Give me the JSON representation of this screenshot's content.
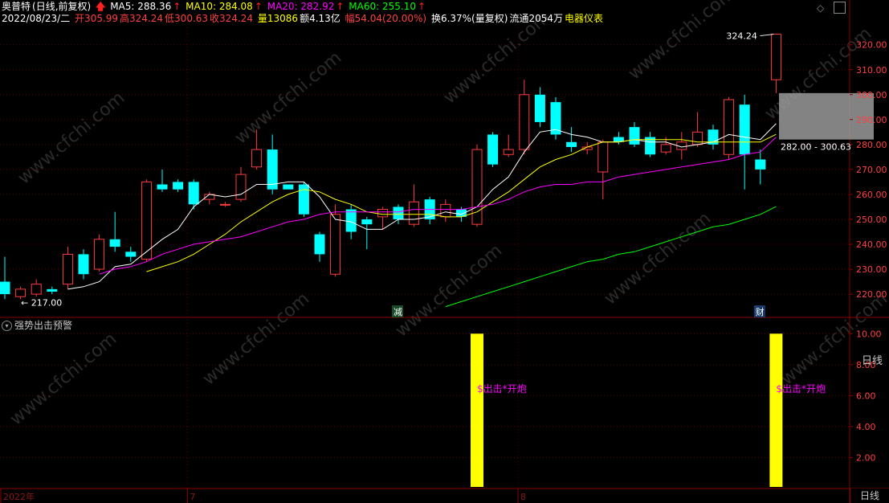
{
  "header": {
    "stock_name": "奥普特",
    "period": "(日线,前复权)",
    "ma5_label": "MA5: 288.36",
    "ma10_label": "MA10: 284.08",
    "ma20_label": "MA20: 282.92",
    "ma60_label": "MA60: 255.10",
    "date": "2022/08/23/二",
    "open": "开305.99",
    "high": "高324.24",
    "low": "低300.63",
    "close": "收324.24",
    "volume": "量13086",
    "amount": "额4.13亿",
    "change": "幅54.04(20.00%)",
    "turnover": "换6.37%(量复权)",
    "float": "流通2054万",
    "sector": "电器仪表"
  },
  "colors": {
    "up": "#ff3c3c",
    "down": "#00ffff",
    "ma5": "#ffffff",
    "ma10": "#ffff00",
    "ma20": "#ff00ff",
    "ma60": "#00ff00",
    "indicator_bar": "#ffff00",
    "indicator_text": "#ff00ff"
  },
  "chart_data": {
    "type": "candlestick",
    "ylim": [
      211,
      327
    ],
    "y_ticks": [
      "320.00",
      "310.00",
      "300.00",
      "290.00",
      "280.00",
      "270.00",
      "260.00",
      "250.00",
      "240.00",
      "230.00",
      "220.00"
    ],
    "candles": [
      {
        "o": 225,
        "c": 220,
        "h": 235,
        "l": 218
      },
      {
        "o": 219,
        "c": 222,
        "h": 223,
        "l": 218
      },
      {
        "o": 220,
        "c": 224,
        "h": 226,
        "l": 219
      },
      {
        "o": 222,
        "c": 221,
        "h": 223,
        "l": 220
      },
      {
        "o": 224,
        "c": 236,
        "h": 239,
        "l": 222
      },
      {
        "o": 236,
        "c": 228,
        "h": 238,
        "l": 226
      },
      {
        "o": 230,
        "c": 242,
        "h": 244,
        "l": 229
      },
      {
        "o": 242,
        "c": 239,
        "h": 253,
        "l": 237
      },
      {
        "o": 237,
        "c": 235,
        "h": 239,
        "l": 233
      },
      {
        "o": 234,
        "c": 265,
        "h": 266,
        "l": 233
      },
      {
        "o": 264,
        "c": 262,
        "h": 270,
        "l": 261
      },
      {
        "o": 265,
        "c": 262,
        "h": 266,
        "l": 261
      },
      {
        "o": 265,
        "c": 256,
        "h": 266,
        "l": 254
      },
      {
        "o": 258,
        "c": 260,
        "h": 261,
        "l": 256
      },
      {
        "o": 256,
        "c": 256,
        "h": 257,
        "l": 255
      },
      {
        "o": 258,
        "c": 268,
        "h": 271,
        "l": 257
      },
      {
        "o": 271,
        "c": 278,
        "h": 286,
        "l": 270
      },
      {
        "o": 278,
        "c": 262,
        "h": 284,
        "l": 260
      },
      {
        "o": 264,
        "c": 262,
        "h": 263,
        "l": 262
      },
      {
        "o": 264,
        "c": 252,
        "h": 265,
        "l": 251
      },
      {
        "o": 244,
        "c": 236,
        "h": 245,
        "l": 233
      },
      {
        "o": 228,
        "c": 252,
        "h": 256,
        "l": 227
      },
      {
        "o": 254,
        "c": 245,
        "h": 256,
        "l": 242
      },
      {
        "o": 250,
        "c": 248,
        "h": 251,
        "l": 238
      },
      {
        "o": 251,
        "c": 254,
        "h": 255,
        "l": 246
      },
      {
        "o": 255,
        "c": 250,
        "h": 256,
        "l": 248
      },
      {
        "o": 248,
        "c": 257,
        "h": 264,
        "l": 247
      },
      {
        "o": 258,
        "c": 250,
        "h": 259,
        "l": 248
      },
      {
        "o": 251,
        "c": 256,
        "h": 258,
        "l": 249
      },
      {
        "o": 254,
        "c": 251,
        "h": 255,
        "l": 249
      },
      {
        "o": 248,
        "c": 278,
        "h": 280,
        "l": 247
      },
      {
        "o": 284,
        "c": 272,
        "h": 285,
        "l": 271
      },
      {
        "o": 276,
        "c": 278,
        "h": 284,
        "l": 275
      },
      {
        "o": 278,
        "c": 300,
        "h": 306,
        "l": 276
      },
      {
        "o": 300,
        "c": 289,
        "h": 303,
        "l": 287
      },
      {
        "o": 297,
        "c": 284,
        "h": 299,
        "l": 282
      },
      {
        "o": 281,
        "c": 279,
        "h": 287,
        "l": 277
      },
      {
        "o": 278,
        "c": 279,
        "h": 281,
        "l": 276
      },
      {
        "o": 269,
        "c": 281,
        "h": 282,
        "l": 258
      },
      {
        "o": 283,
        "c": 281,
        "h": 285,
        "l": 280
      },
      {
        "o": 287,
        "c": 280,
        "h": 289,
        "l": 279
      },
      {
        "o": 283,
        "c": 276,
        "h": 285,
        "l": 275
      },
      {
        "o": 277,
        "c": 280,
        "h": 283,
        "l": 276
      },
      {
        "o": 278,
        "c": 281,
        "h": 285,
        "l": 274
      },
      {
        "o": 280,
        "c": 285,
        "h": 293,
        "l": 279
      },
      {
        "o": 286,
        "c": 280,
        "h": 288,
        "l": 278
      },
      {
        "o": 276,
        "c": 298,
        "h": 299,
        "l": 274
      },
      {
        "o": 296,
        "c": 276,
        "h": 300,
        "l": 262
      },
      {
        "o": 274,
        "c": 270,
        "h": 278,
        "l": 264
      },
      {
        "o": 305.99,
        "c": 324.24,
        "h": 324.24,
        "l": 300.63
      }
    ],
    "ma5": [
      null,
      null,
      null,
      null,
      222,
      223,
      225,
      231,
      232,
      237,
      242,
      246,
      255,
      260,
      259,
      260,
      264,
      264,
      265,
      265,
      259,
      250,
      249,
      246,
      246,
      250,
      250,
      251,
      253,
      252,
      255,
      262,
      267,
      277,
      285,
      286,
      284,
      283,
      281,
      281,
      282,
      281,
      281,
      279,
      280,
      281,
      284,
      283,
      282,
      288.36
    ],
    "ma10": [
      null,
      null,
      null,
      null,
      null,
      null,
      null,
      null,
      null,
      229,
      231,
      233,
      236,
      240,
      244,
      249,
      253,
      257,
      260,
      262,
      261,
      258,
      256,
      253,
      252,
      252,
      252,
      252,
      251,
      251,
      253,
      257,
      261,
      266,
      271,
      274,
      276,
      279,
      281,
      281,
      282,
      282,
      282,
      282,
      281,
      281,
      281,
      281,
      281,
      284.08
    ],
    "ma20": [
      null,
      null,
      null,
      null,
      null,
      null,
      228,
      230,
      231,
      233,
      236,
      238,
      240,
      241,
      242,
      243,
      245,
      247,
      249,
      250,
      252,
      253,
      253,
      253,
      253,
      253,
      254,
      254,
      254,
      254,
      255,
      256,
      258,
      261,
      263,
      264,
      264,
      265,
      265,
      267,
      268,
      269,
      270,
      271,
      272,
      273,
      274,
      276,
      277,
      282.92
    ],
    "ma60": [
      null,
      null,
      null,
      null,
      null,
      null,
      null,
      null,
      null,
      null,
      null,
      null,
      null,
      null,
      null,
      null,
      null,
      null,
      null,
      null,
      null,
      null,
      null,
      null,
      null,
      null,
      null,
      null,
      215,
      217,
      219,
      221,
      223,
      225,
      227,
      229,
      231,
      233,
      234,
      236,
      237,
      239,
      241,
      243,
      245,
      247,
      248,
      250,
      252,
      255.1
    ],
    "high_marker": "324.24",
    "low_marker": "← 217.00",
    "range_label": "282.00 - 300.63",
    "range_box": [
      282.0,
      300.63
    ],
    "event_labels": [
      {
        "index": 25,
        "text": "减"
      },
      {
        "index": 48,
        "text": "财"
      }
    ],
    "time_labels": [
      {
        "index": 0,
        "text": "2022年"
      },
      {
        "index": 12,
        "text": "7"
      },
      {
        "index": 33,
        "text": "8"
      }
    ]
  },
  "indicator": {
    "title": "强势出击预警",
    "ylim": [
      0,
      11
    ],
    "y_ticks": [
      "10.00",
      "8.00",
      "6.00",
      "4.00",
      "2.00"
    ],
    "bars": [
      {
        "index": 30,
        "value": 10,
        "label": "$出击*开炮"
      },
      {
        "index": 49,
        "value": 10,
        "label": "$出击*开炮"
      }
    ]
  },
  "side_tab": "日线",
  "corner_tab": "日线",
  "watermark": "www.cfchi.com"
}
